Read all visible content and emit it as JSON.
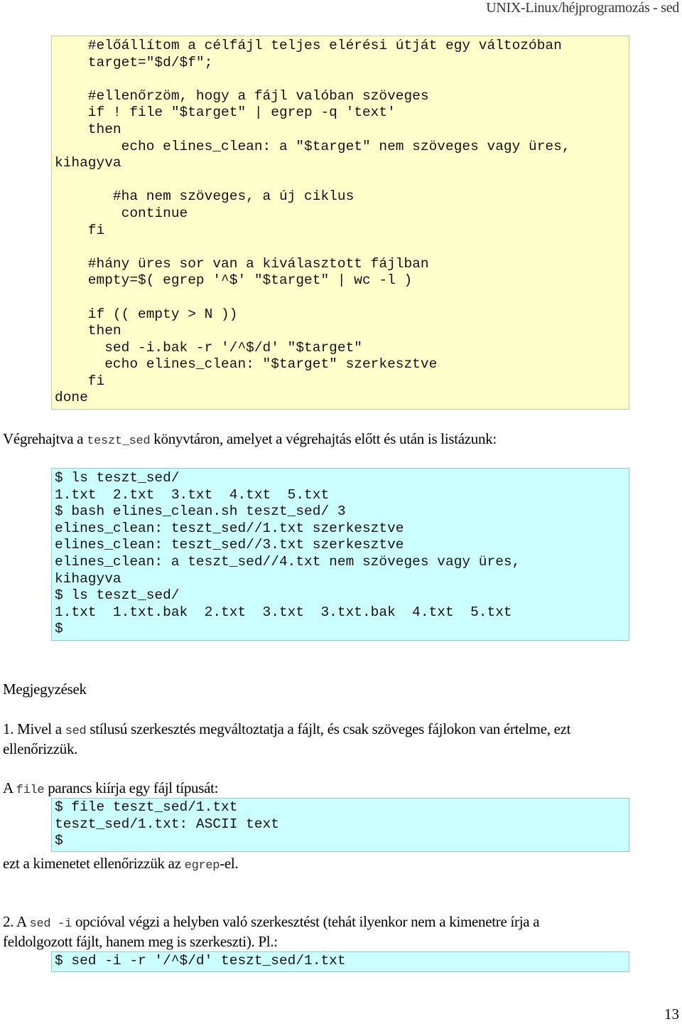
{
  "header": {
    "title": "UNIX-Linux/héjprogramozás - sed"
  },
  "script_block": {
    "lines": [
      "    #előállítom a célfájl teljes elérési útját egy változóban",
      "    target=\"$d/$f\";",
      "",
      "    #ellenőrzöm, hogy a fájl valóban szöveges",
      "    if ! file \"$target\" | egrep -q 'text'",
      "    then",
      "        echo elines_clean: a \"$target\" nem szöveges vagy üres,",
      "kihagyva",
      "",
      "       #ha nem szöveges, a új ciklus",
      "        continue",
      "    fi",
      "",
      "    #hány üres sor van a kiválasztott fájlban",
      "    empty=$( egrep '^$' \"$target\" | wc -l )",
      "",
      "    if (( empty > N ))",
      "    then",
      "      sed -i.bak -r '/^$/d' \"$target\"",
      "      echo elines_clean: \"$target\" szerkesztve",
      "    fi",
      "done"
    ]
  },
  "intro_paragraph": {
    "before": "Végrehajtva a ",
    "code": "teszt_sed",
    "after": " könyvtáron, amelyet a végrehajtás előtt és után is listázunk:"
  },
  "run_block": {
    "lines": [
      "$ ls teszt_sed/",
      "1.txt  2.txt  3.txt  4.txt  5.txt",
      "$ bash elines_clean.sh teszt_sed/ 3",
      "elines_clean: teszt_sed//1.txt szerkesztve",
      "elines_clean: teszt_sed//3.txt szerkesztve",
      "elines_clean: a teszt_sed//4.txt nem szöveges vagy üres,",
      "kihagyva",
      "$ ls teszt_sed/",
      "1.txt  1.txt.bak  2.txt  3.txt  3.txt.bak  4.txt  5.txt",
      "$"
    ]
  },
  "notes": {
    "heading": "Megjegyzések",
    "note1": {
      "before": "1. Mivel a ",
      "code": "sed",
      "after_line1": " stílusú szerkesztés megváltoztatja a fájlt, és csak szöveges fájlokon van értelme, ezt",
      "line2": "ellenőrizzük."
    },
    "file_para": {
      "before": "A ",
      "code": "file",
      "after": " parancs kiírja egy fájl típusát:"
    },
    "file_block": {
      "lines": [
        "$ file teszt_sed/1.txt",
        "teszt_sed/1.txt: ASCII text",
        "$"
      ]
    },
    "egrep_para": {
      "before": "ezt a kimenetet ellenőrizzük az ",
      "code": "egrep",
      "after": "-el."
    },
    "note2": {
      "before": "2. A ",
      "code": "sed -i",
      "after_line1": " opcióval végzi a helyben való szerkesztést (tehát ilyenkor nem a kimenetre írja a",
      "line2": "feldolgozott fájlt, hanem meg is szerkeszti). Pl.:"
    },
    "sed_block": {
      "lines": [
        "$ sed -i -r '/^$/d' teszt_sed/1.txt"
      ]
    }
  },
  "footer": {
    "page_number": "13"
  }
}
